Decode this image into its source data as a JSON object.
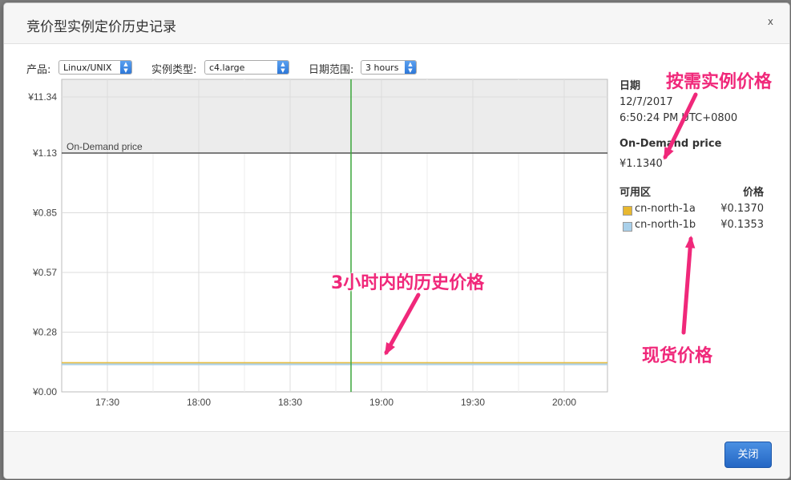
{
  "dialog": {
    "title": "竞价型实例定价历史记录",
    "close_label": "x",
    "close_button_label": "关闭"
  },
  "filters": {
    "product_label": "产品:",
    "product_value": "Linux/UNIX",
    "instance_type_label": "实例类型:",
    "instance_type_value": "c4.large",
    "date_range_label": "日期范围:",
    "date_range_value": "3 hours"
  },
  "chart_data": {
    "type": "line",
    "x_ticks": [
      "17:30",
      "18:00",
      "18:30",
      "19:00",
      "19:30",
      "20:00"
    ],
    "y_ticks": [
      "¥0.00",
      "¥0.28",
      "¥0.57",
      "¥0.85",
      "¥1.13",
      "¥11.34"
    ],
    "ondemand_label": "On-Demand price",
    "ondemand_price": 1.134,
    "series": [
      {
        "name": "cn-north-1a",
        "value": 0.137,
        "color": "#e8b830"
      },
      {
        "name": "cn-north-1b",
        "value": 0.1353,
        "color": "#a9d0ea"
      }
    ],
    "cursor_time": "18:50",
    "cursor_color": "#3aa53a",
    "ondemand_region_color": "#ececec"
  },
  "side": {
    "date_label": "日期",
    "date_value": "12/7/2017",
    "time_value": "6:50:24 PM UTC+0800",
    "ondemand_label": "On-Demand price",
    "ondemand_value": "¥1.1340",
    "az_header": "可用区",
    "price_header": "价格",
    "rows": [
      {
        "az": "cn-north-1a",
        "price": "¥0.1370",
        "color": "#e8b830"
      },
      {
        "az": "cn-north-1b",
        "price": "¥0.1353",
        "color": "#a9d0ea"
      }
    ]
  },
  "annotations": {
    "ondemand": "按需实例价格",
    "history": "3小时内的历史价格",
    "spot": "现货价格",
    "color": "#f0287a"
  }
}
